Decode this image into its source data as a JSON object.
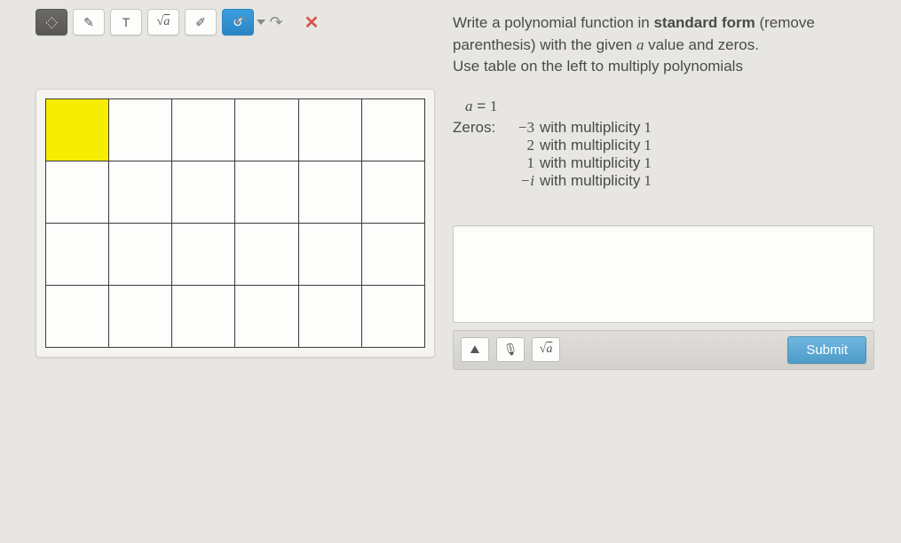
{
  "toolbar": {
    "items": [
      {
        "name": "link-tool",
        "label": "⟲",
        "active": true
      },
      {
        "name": "pencil-tool",
        "label": "✎"
      },
      {
        "name": "text-tool",
        "label": "T"
      },
      {
        "name": "math-tool",
        "label": "√a"
      },
      {
        "name": "eraser-tool",
        "label": "✐"
      },
      {
        "name": "color-tool",
        "label": "↺",
        "blue": true
      }
    ]
  },
  "top_icons": {
    "undo": "↶",
    "redo": "↷",
    "close": "✕"
  },
  "prompt": {
    "line1a": "Write a polynomial function in ",
    "line1b": "standard form",
    "line1c": " (remove",
    "line2a": "parenthesis) with the given ",
    "line2var": "a",
    "line2b": " value and zeros.",
    "line3": "Use table on the left to multiply polynomials"
  },
  "given": {
    "a_label": "a",
    "a_eq": " = ",
    "a_val": "1",
    "zeros_label": "Zeros:",
    "mult_word": "with multiplicity",
    "rows": [
      {
        "val": "−3",
        "mult": "1"
      },
      {
        "val": "2",
        "mult": "1"
      },
      {
        "val": "1",
        "mult": "1"
      },
      {
        "val": "−i",
        "mult": "1"
      }
    ]
  },
  "answer_toolbar": {
    "image": "▲",
    "mic": "🎤",
    "math": "√a"
  },
  "submit_label": "Submit",
  "table": {
    "rows": 4,
    "cols": 6,
    "highlight": [
      0,
      0
    ]
  }
}
